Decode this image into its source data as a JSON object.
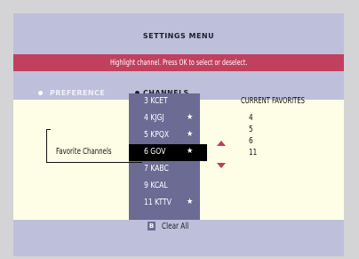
{
  "header": {
    "title": "SETTINGS MENU"
  },
  "instruction": "Highlight channel. Press OK to select or deselect.",
  "tabs": [
    {
      "label": "PREFERENCE",
      "active": false
    },
    {
      "label": "CHANNELS",
      "active": true
    }
  ],
  "favorite_channels_label": "Favorite Channels",
  "channels": [
    {
      "label": "3 KCET",
      "favorite": false,
      "selected": false
    },
    {
      "label": "4 KJGJ",
      "favorite": true,
      "selected": false
    },
    {
      "label": "5 KPQX",
      "favorite": true,
      "selected": false
    },
    {
      "label": "6 GOV",
      "favorite": true,
      "selected": true
    },
    {
      "label": "7 KABC",
      "favorite": false,
      "selected": false
    },
    {
      "label": "9 KCAL",
      "favorite": false,
      "selected": false
    },
    {
      "label": "11 KTTV",
      "favorite": true,
      "selected": false
    }
  ],
  "star_glyph": "★",
  "current_favorites": {
    "title": "CURRENT FAVORITES",
    "items": [
      "4",
      "5",
      "6",
      "11"
    ]
  },
  "footer": {
    "button_key": "B",
    "action_label": "Clear All"
  },
  "colors": {
    "header_bg": "#bebfda",
    "instruction_bg": "#c0405e",
    "content_bg": "#fefee6",
    "channel_column_bg": "#6c6b94",
    "selected_row_bg": "#000000",
    "scroll_arrow": "#c03a62"
  }
}
